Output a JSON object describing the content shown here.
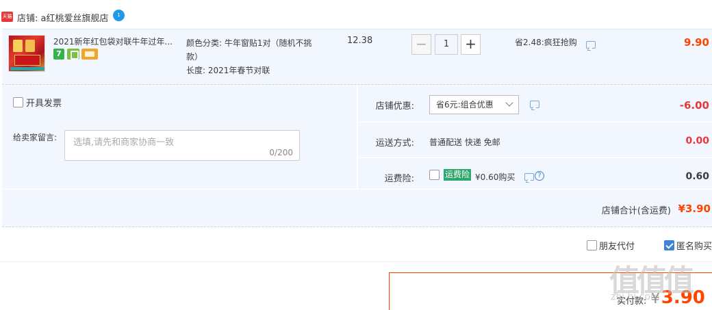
{
  "shop": {
    "badge": "天猫",
    "label": "店铺: a红桃爱丝旗舰店",
    "wangwang_icon": "wangwang-chat-icon"
  },
  "item": {
    "title": "2021新年红包袋对联牛年过年...",
    "service_badge_7": "7",
    "sku_color": "颜色分类: 牛年窗贴1对（随机不挑款）",
    "sku_length": "长度: 2021年春节对联",
    "unit_price": "12.38",
    "quantity": "1",
    "minus_label": "−",
    "plus_label": "+",
    "promo": "省2.48:疯狂抢购",
    "total": "9.90"
  },
  "options": {
    "invoice_label": "开具发票",
    "memo_label": "给卖家留言:",
    "memo_placeholder": "选填,请先和商家协商一致",
    "memo_count": "0/200",
    "discount_label": "店铺优惠:",
    "discount_value": "省6元:组合优惠",
    "discount_amount": "-6.00",
    "shipping_label": "运送方式:",
    "shipping_value": "普通配送 快递 免邮",
    "shipping_amount": "0.00",
    "insurance_label": "运费险:",
    "insurance_badge": "运费险",
    "insurance_price": "¥0.60购买",
    "insurance_amount": "0.60"
  },
  "summary": {
    "label": "店铺合计(含运费)",
    "value": "¥3.90"
  },
  "footer": {
    "friend_pay": "朋友代付",
    "anonymous": "匿名购买",
    "pay_label": "实付款:",
    "pay_currency": "¥",
    "pay_amount": "3.90"
  },
  "watermark": {
    "logo": "值值值",
    "url": "zhi.hi.com"
  },
  "colors": {
    "accent": "#ff4400",
    "panel": "#f2f7ff",
    "blue": "#3d84d6",
    "green": "#2fa66b"
  }
}
